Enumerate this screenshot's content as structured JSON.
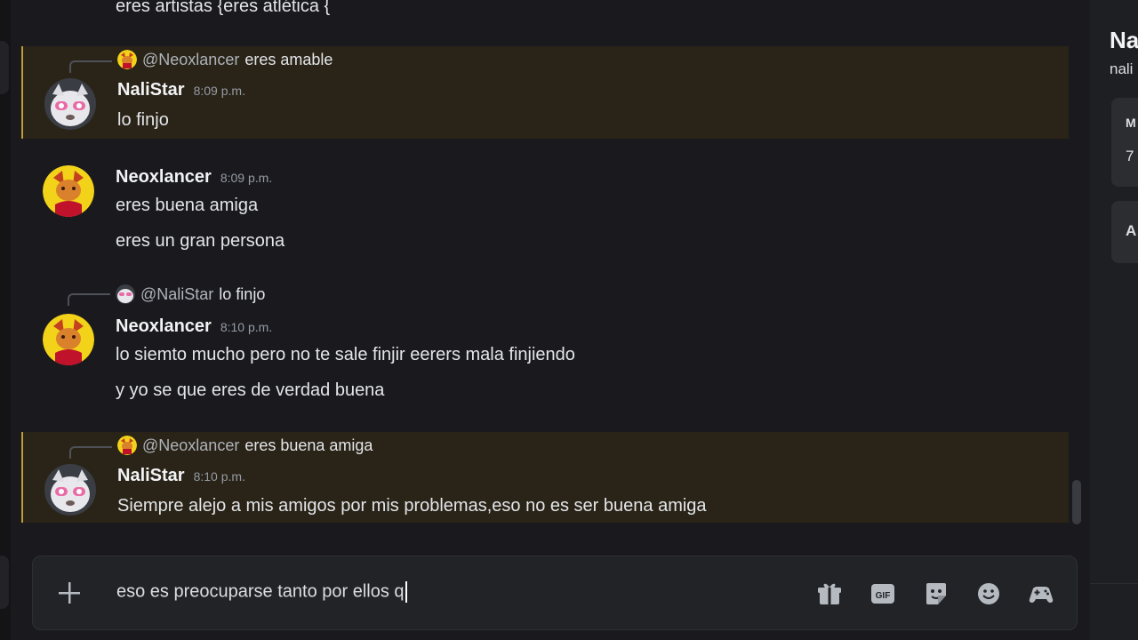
{
  "chat": {
    "partial_top_text": "eres artistas {eres atlética {",
    "messages": [
      {
        "reply_to_user": "@Neoxlancer",
        "reply_snippet": "eres amable",
        "author": "NaliStar",
        "time": "8:09 p.m.",
        "lines": [
          "lo finjo"
        ]
      },
      {
        "author": "Neoxlancer",
        "time": "8:09 p.m.",
        "lines": [
          "eres buena amiga",
          "eres un gran persona"
        ]
      },
      {
        "reply_to_user": "@NaliStar",
        "reply_snippet": "lo finjo",
        "author": "Neoxlancer",
        "time": "8:10 p.m.",
        "lines": [
          "lo siemto mucho pero no te sale finjir eerers mala finjiendo",
          "y yo se que eres de verdad buena"
        ]
      },
      {
        "reply_to_user": "@Neoxlancer",
        "reply_snippet": "eres buena amiga",
        "author": "NaliStar",
        "time": "8:10 p.m.",
        "lines": [
          "Siempre alejo a mis amigos por mis problemas,eso no es ser buena amiga"
        ]
      }
    ]
  },
  "composer": {
    "input_value": "eso es preocuparse tanto por ellos q",
    "tools": [
      "gift-icon",
      "gif-icon",
      "sticker-icon",
      "emoji-icon",
      "activities-icon"
    ],
    "gif_label": "GIF"
  },
  "profile_panel": {
    "title_partial": "Na",
    "subtitle_partial": "nali",
    "card1_label_partial": "M",
    "card1_value_partial": "7",
    "card2_label_partial": "A"
  },
  "colors": {
    "mention_bg": "#2a2418",
    "mention_bar": "#c29a3b",
    "background": "#1a1a1e"
  }
}
